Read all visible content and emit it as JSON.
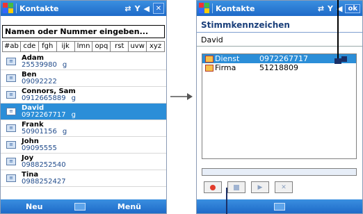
{
  "left": {
    "title": "Kontakte",
    "search_placeholder": "Namen oder Nummer eingeben...",
    "alpha_tabs": [
      "#ab",
      "cde",
      "fgh",
      "ijk",
      "lmn",
      "opq",
      "rst",
      "uvw",
      "xyz"
    ],
    "contacts": [
      {
        "name": "Adam",
        "number": "25539980",
        "tag": "g"
      },
      {
        "name": "Ben",
        "number": "09092222",
        "tag": ""
      },
      {
        "name": "Connors, Sam",
        "number": "0912665889",
        "tag": "g"
      },
      {
        "name": "David",
        "number": "0972267717",
        "tag": "g"
      },
      {
        "name": "Frank",
        "number": "50901156",
        "tag": "g"
      },
      {
        "name": "John",
        "number": "09095555",
        "tag": ""
      },
      {
        "name": "Joy",
        "number": "0988252540",
        "tag": ""
      },
      {
        "name": "Tina",
        "number": "0988252427",
        "tag": ""
      }
    ],
    "selected_contact": "David",
    "softkey_left": "Neu",
    "softkey_right": "Menü"
  },
  "right": {
    "title": "Kontakte",
    "ok_label": "ok",
    "subtitle": "Stimmkennzeichen",
    "contact_name": "David",
    "entries": [
      {
        "label": "Dienst",
        "number": "0972267717",
        "selected": true
      },
      {
        "label": "Firma",
        "number": "51218809",
        "selected": false
      }
    ]
  },
  "colors": {
    "titlebar": "#1e6ac8",
    "selection": "#2b8ed8"
  }
}
